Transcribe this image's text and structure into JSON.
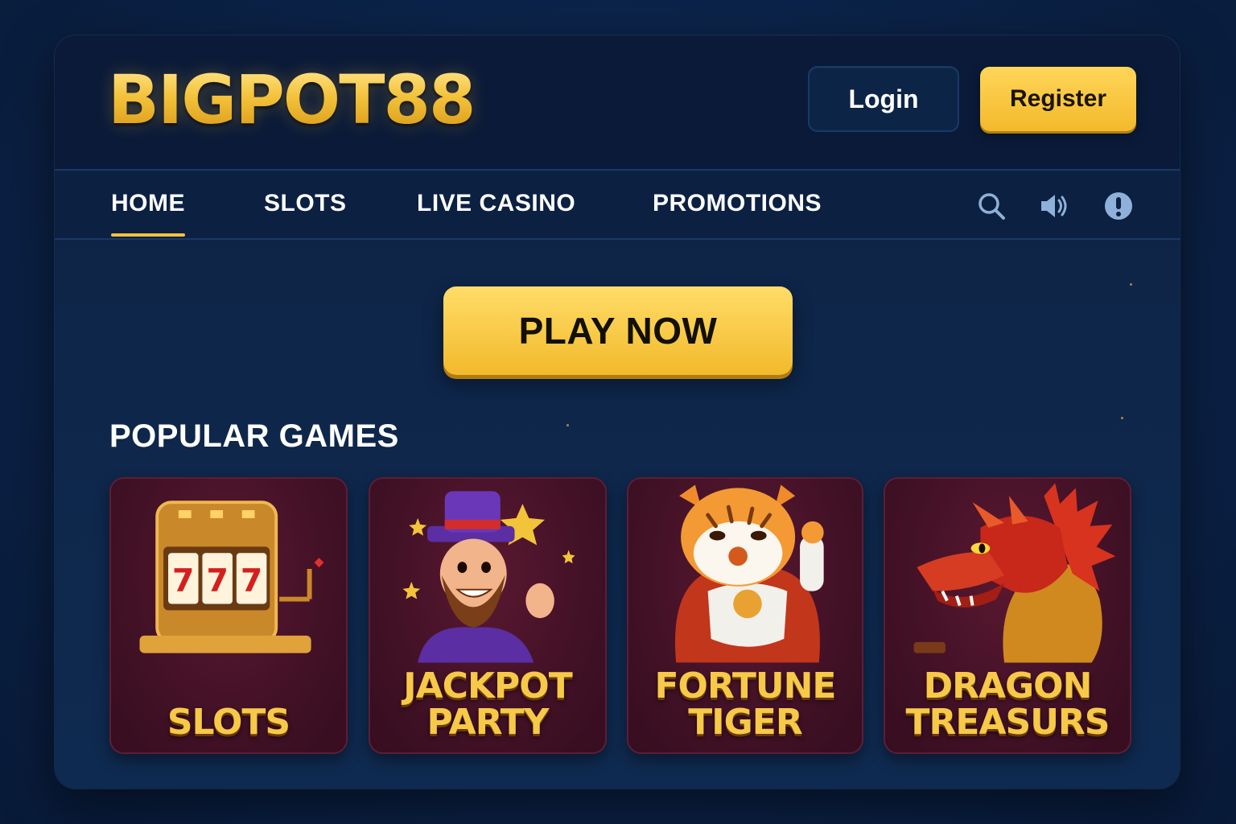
{
  "header": {
    "logo": "BIGPOT88",
    "login_label": "Login",
    "register_label": "Register"
  },
  "nav": {
    "items": [
      {
        "label": "HOME",
        "active": true
      },
      {
        "label": "SLOTS",
        "active": false
      },
      {
        "label": "LIVE CASINO",
        "active": false
      },
      {
        "label": "PROMOTIONS",
        "active": false
      }
    ],
    "icons": [
      "search-icon",
      "speaker-icon",
      "info-icon"
    ]
  },
  "hero": {
    "cta_label": "PLAY NOW"
  },
  "popular": {
    "title": "POPULAR GAMES",
    "games": [
      {
        "label": "SLOTS",
        "art": "slot-machine-icon"
      },
      {
        "label": "JACKPOT\nPARTY",
        "art": "leprechaun-icon"
      },
      {
        "label": "FORTUNE\nTIGER",
        "art": "tiger-icon"
      },
      {
        "label": "DRAGON\nTREASURS",
        "art": "dragon-icon"
      }
    ]
  },
  "colors": {
    "gold": "#f5c23a",
    "navy": "#0a1a38",
    "card": "#421126"
  }
}
